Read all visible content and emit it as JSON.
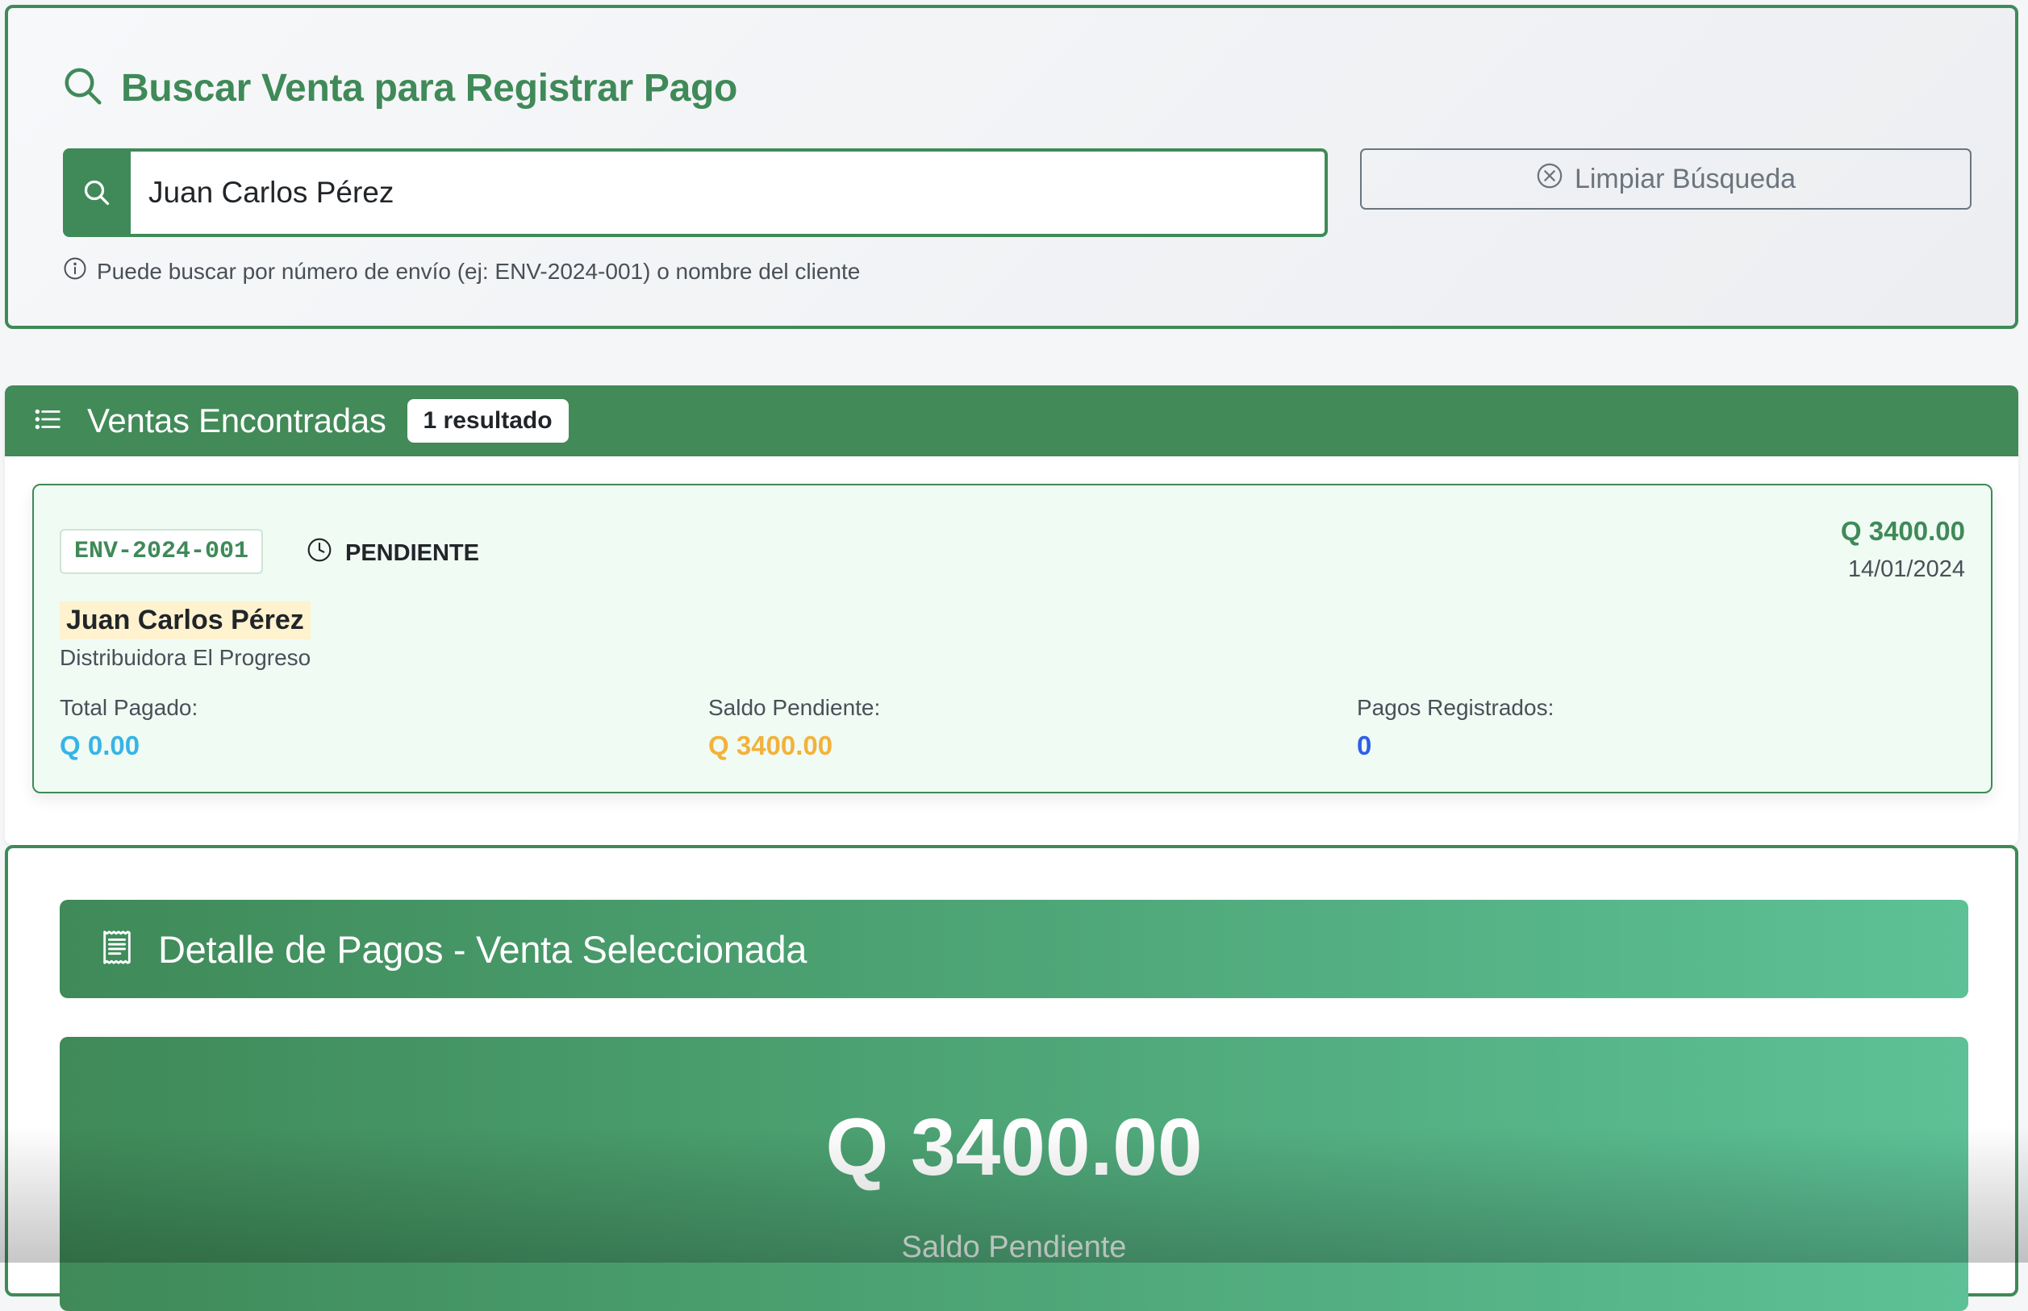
{
  "search": {
    "title": "Buscar Venta para Registrar Pago",
    "input_value": "Juan Carlos Pérez",
    "clear_label": "Limpiar Búsqueda",
    "hint": "Puede buscar por número de envío (ej: ENV-2024-001) o nombre del cliente"
  },
  "results": {
    "title": "Ventas Encontradas",
    "count_badge": "1 resultado",
    "items": [
      {
        "code": "ENV-2024-001",
        "status": "PENDIENTE",
        "amount": "Q 3400.00",
        "date": "14/01/2024",
        "client_name": "Juan Carlos Pérez",
        "company": "Distribuidora El Progreso",
        "total_paid_label": "Total Pagado:",
        "total_paid": "Q 0.00",
        "balance_label": "Saldo Pendiente:",
        "balance": "Q 3400.00",
        "payments_label": "Pagos Registrados:",
        "payments": "0"
      }
    ]
  },
  "detail": {
    "title": "Detalle de Pagos - Venta Seleccionada",
    "balance_amount": "Q 3400.00",
    "balance_label": "Saldo Pendiente"
  },
  "colors": {
    "brand_green": "#3f8a58",
    "info": "#36b4e6",
    "warning": "#f2b23a",
    "primary": "#2f5fe8"
  },
  "icons": {
    "title_icon": "search-icon",
    "input_icon": "search-icon",
    "clear_icon": "x-circle-icon",
    "hint_icon": "info-circle-icon",
    "results_icon": "list-icon",
    "status_icon": "clock-icon",
    "detail_icon": "receipt-icon"
  }
}
